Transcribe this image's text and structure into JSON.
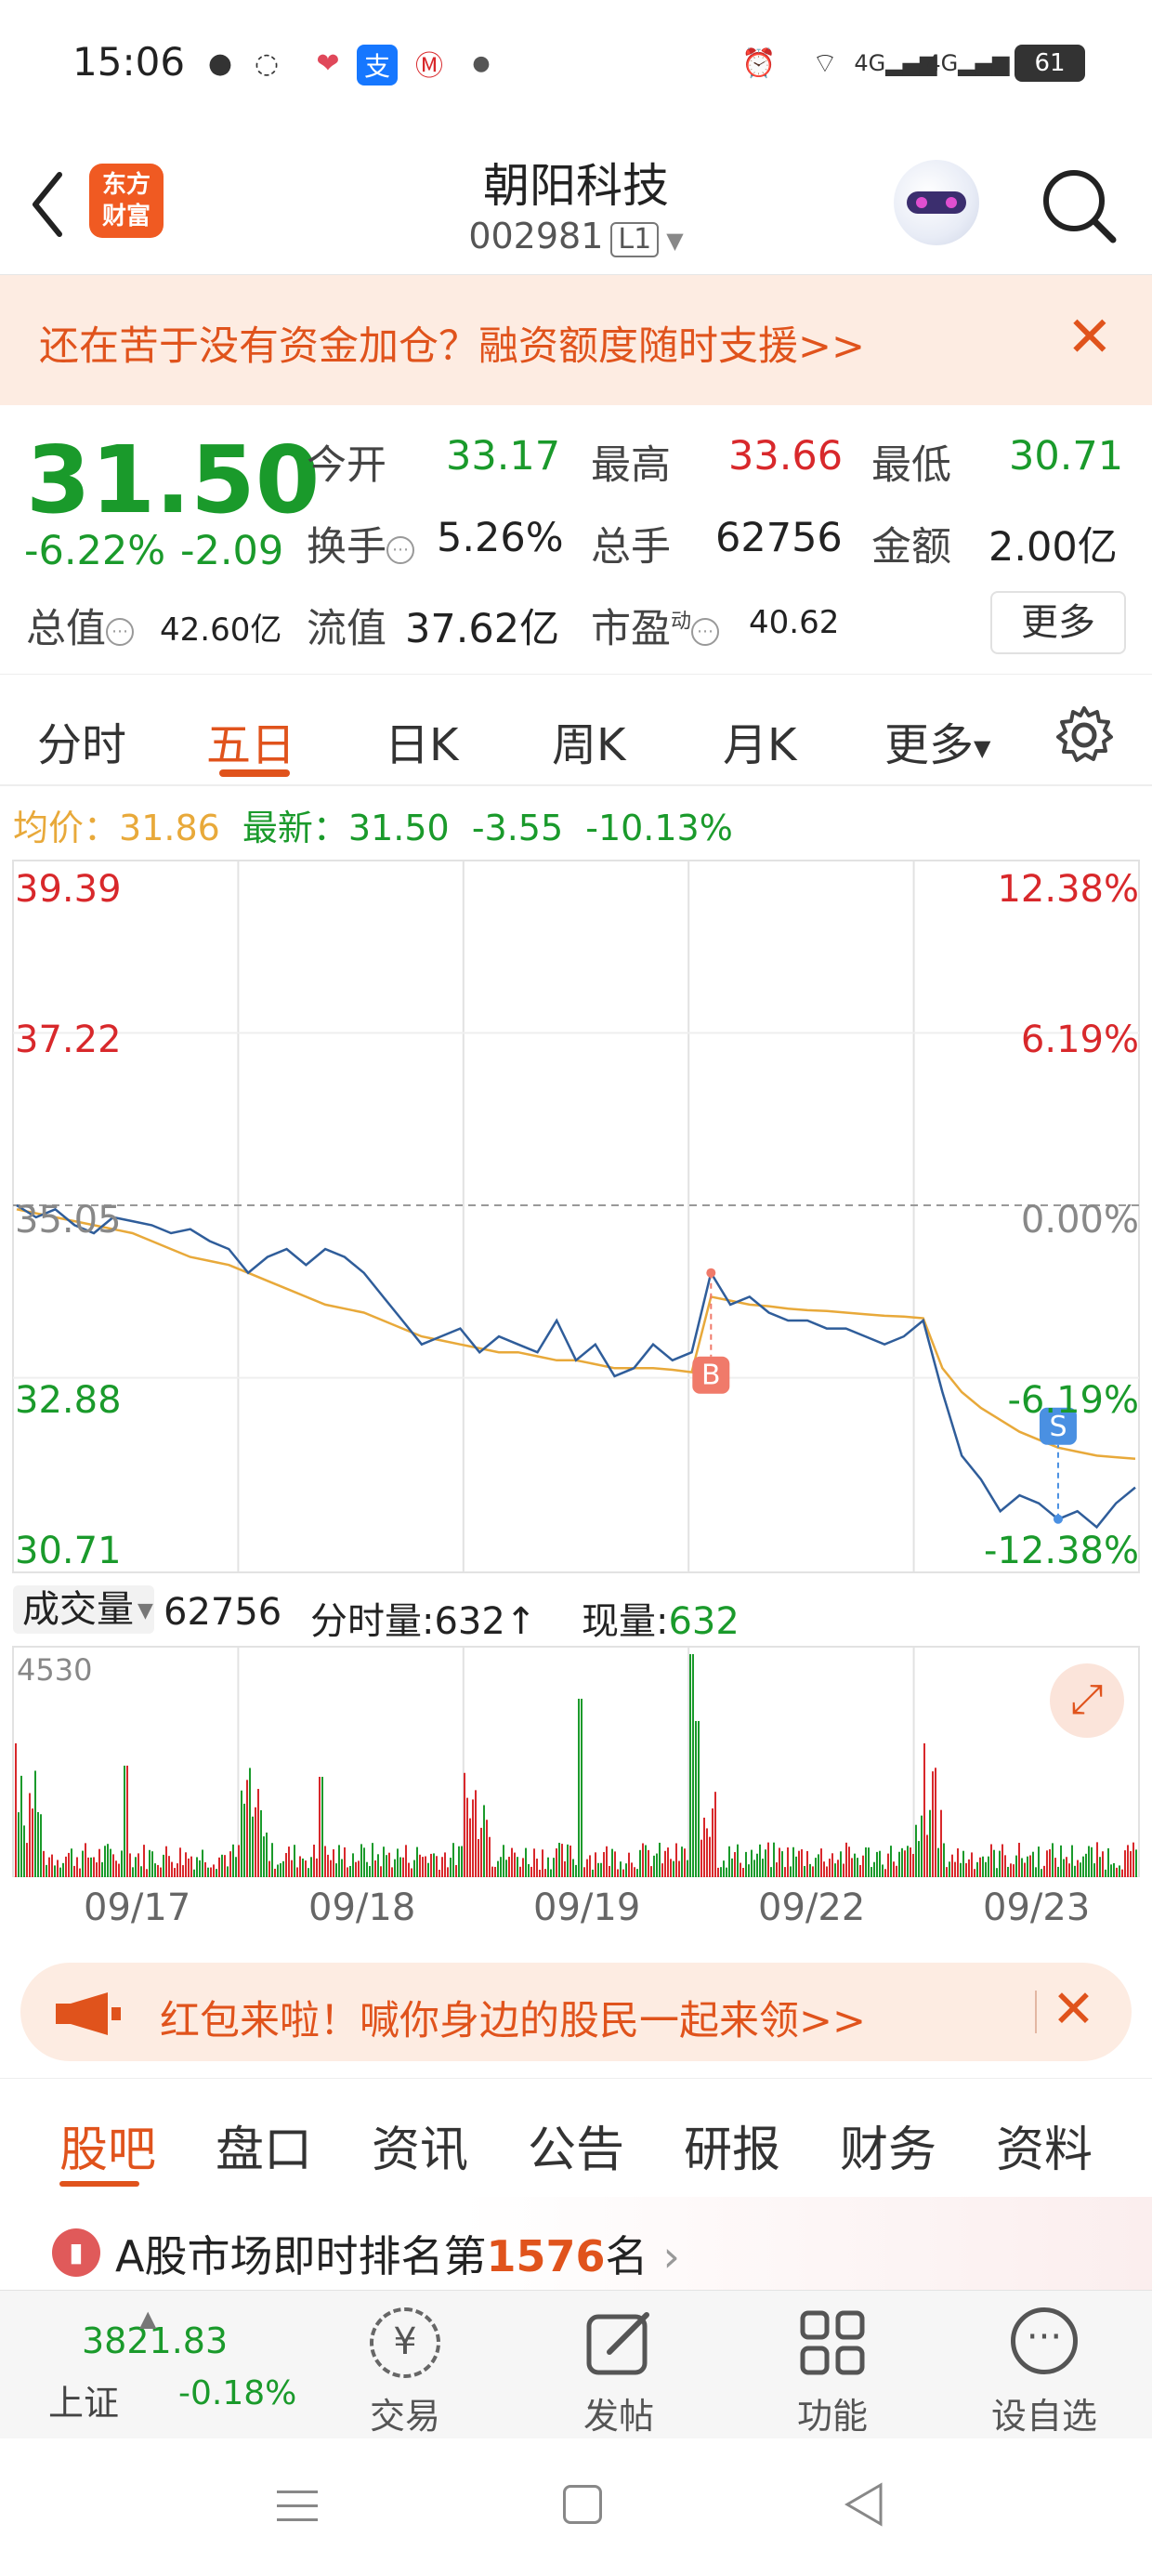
{
  "status_bar": {
    "time": "15:06",
    "battery": "61",
    "network": "4G"
  },
  "header": {
    "back_icon": "chevron-left-icon",
    "logo_line1": "东方",
    "logo_line2": "财富",
    "stock_name": "朝阳科技",
    "stock_code": "002981",
    "level": "L1"
  },
  "ad_banner": {
    "text": "还在苦于没有资金加仓？融资额度随时支援>>"
  },
  "quote": {
    "price": "31.50",
    "change_pct": "-6.22%",
    "change": "-2.09",
    "open_label": "今开",
    "open": "33.17",
    "high_label": "最高",
    "high": "33.66",
    "low_label": "最低",
    "low": "30.71",
    "turnover_label": "换手",
    "turnover": "5.26%",
    "volume_label": "总手",
    "volume": "62756",
    "amount_label": "金额",
    "amount": "2.00亿",
    "mktcap_label": "总值",
    "mktcap": "42.60亿",
    "float_label": "流值",
    "float_cap": "37.62亿",
    "pe_label": "市盈",
    "pe_sup": "动",
    "pe": "40.62",
    "more_label": "更多"
  },
  "chart_tabs": [
    "分时",
    "五日",
    "日K",
    "周K",
    "月K",
    "更多"
  ],
  "chart_info": {
    "avg_label": "均价：",
    "avg": "31.86",
    "latest_label": "最新：",
    "latest": "31.50",
    "latest_chg": "-3.55",
    "latest_pct": "-10.13%"
  },
  "chart_data": {
    "type": "line",
    "x_categories": [
      "09/17",
      "09/18",
      "09/19",
      "09/22",
      "09/23"
    ],
    "y_left_ticks": [
      "39.39",
      "37.22",
      "35.05",
      "32.88",
      "30.71"
    ],
    "y_right_ticks": [
      "12.38%",
      "6.19%",
      "0.00%",
      "-6.19%",
      "-12.38%"
    ],
    "ylim": [
      30.71,
      39.39
    ],
    "prev_close": 35.05,
    "series": [
      {
        "values": [
          35.05,
          34.9,
          35.0,
          34.8,
          34.7,
          34.9,
          34.85,
          34.8,
          34.7,
          34.75,
          34.6,
          34.5,
          34.2,
          34.4,
          34.5,
          34.3,
          34.5,
          34.4,
          34.2,
          33.9,
          33.6,
          33.3,
          33.4,
          33.5,
          33.2,
          33.4,
          33.3,
          33.2,
          33.6,
          33.1,
          33.3,
          32.9,
          33.0,
          33.3,
          33.1,
          33.2,
          34.2,
          33.8,
          33.9,
          33.7,
          33.6,
          33.6,
          33.5,
          33.5,
          33.4,
          33.3,
          33.4,
          33.6,
          32.7,
          31.9,
          31.6,
          31.2,
          31.4,
          31.3,
          31.1,
          31.2,
          31.0,
          31.3,
          31.5
        ]
      },
      {
        "values": [
          35.0,
          34.95,
          34.9,
          34.85,
          34.8,
          34.75,
          34.7,
          34.6,
          34.5,
          34.4,
          34.35,
          34.3,
          34.2,
          34.1,
          34.0,
          33.9,
          33.8,
          33.75,
          33.7,
          33.6,
          33.5,
          33.4,
          33.35,
          33.3,
          33.25,
          33.2,
          33.2,
          33.15,
          33.1,
          33.1,
          33.05,
          33.0,
          33.0,
          33.0,
          32.98,
          32.95,
          33.9,
          33.85,
          33.8,
          33.78,
          33.75,
          33.73,
          33.72,
          33.7,
          33.68,
          33.66,
          33.65,
          33.63,
          33.0,
          32.7,
          32.5,
          32.35,
          32.2,
          32.1,
          32.0,
          31.95,
          31.9,
          31.88,
          31.86
        ]
      }
    ],
    "markers": [
      {
        "label": "B"
      },
      {
        "label": "S"
      }
    ],
    "volume_label": "成交量",
    "volume_total": "62756",
    "tick_vol_label": "分时量:",
    "tick_vol": "632",
    "now_vol_label": "现量:",
    "now_vol": "632",
    "volume_max_label": "4530"
  },
  "red_packet": {
    "text": "红包来啦！喊你身边的股民一起来领>>"
  },
  "sub_tabs": [
    "股吧",
    "盘口",
    "资讯",
    "公告",
    "研报",
    "财务",
    "资料"
  ],
  "rank": {
    "prefix": "A股市场即时排名第",
    "num": "1576",
    "suffix": "名"
  },
  "toolbar": {
    "index_value": "3821.83",
    "index_name": "上证",
    "index_pct": "-0.18%",
    "items": [
      "交易",
      "发帖",
      "功能",
      "设自选"
    ]
  },
  "colors": {
    "accent": "#e0531c",
    "up": "#d8282b",
    "down": "#1a9a2b",
    "avg": "#e8a93a",
    "line": "#2f5d9a"
  }
}
